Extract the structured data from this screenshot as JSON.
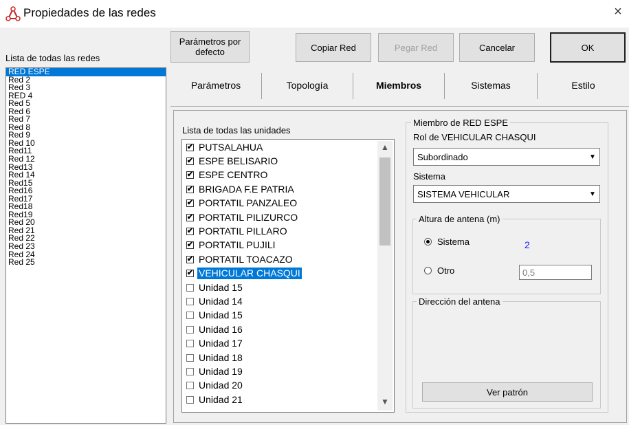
{
  "window": {
    "title": "Propiedades de las redes",
    "close_label": "×",
    "icon": "network-antenna-icon"
  },
  "toolbar": {
    "defaults_label": "Parámetros por defecto",
    "copy_label": "Copiar Red",
    "paste_label": "Pegar Red",
    "cancel_label": "Cancelar",
    "ok_label": "OK"
  },
  "networks": {
    "heading": "Lista de todas las redes",
    "selected": "RED ESPE",
    "items": [
      "RED ESPE",
      "Red  2",
      "Red  3",
      "RED 4",
      "Red  5",
      "Red  6",
      "Red  7",
      "Red  8",
      "Red  9",
      "Red 10",
      "Red11",
      "Red 12",
      "Red13",
      "Red 14",
      "Red15",
      "Red16",
      "Red17",
      "Red18",
      "Red19",
      "Red 20",
      "Red 21",
      "Red 22",
      "Red 23",
      "Red 24",
      "Red 25"
    ]
  },
  "tabs": [
    {
      "label": "Parámetros",
      "active": false
    },
    {
      "label": "Topología",
      "active": false
    },
    {
      "label": "Miembros",
      "active": true
    },
    {
      "label": "Sistemas",
      "active": false
    },
    {
      "label": "Estilo",
      "active": false
    }
  ],
  "units": {
    "heading": "Lista de todas las unidades",
    "items": [
      {
        "label": "PUTSALAHUA",
        "checked": true,
        "selected": false
      },
      {
        "label": "ESPE BELISARIO",
        "checked": true,
        "selected": false
      },
      {
        "label": "ESPE CENTRO",
        "checked": true,
        "selected": false
      },
      {
        "label": "BRIGADA F.E PATRIA",
        "checked": true,
        "selected": false
      },
      {
        "label": "PORTATIL PANZALEO",
        "checked": true,
        "selected": false
      },
      {
        "label": "PORTATIL PILIZURCO",
        "checked": true,
        "selected": false
      },
      {
        "label": "PORTATIL PILLARO",
        "checked": true,
        "selected": false
      },
      {
        "label": "PORTATIL PUJILI",
        "checked": true,
        "selected": false
      },
      {
        "label": "PORTATIL  TOACAZO",
        "checked": true,
        "selected": false
      },
      {
        "label": "VEHICULAR CHASQUI",
        "checked": true,
        "selected": true
      },
      {
        "label": "Unidad  15",
        "checked": false,
        "selected": false
      },
      {
        "label": "Unidad  14",
        "checked": false,
        "selected": false
      },
      {
        "label": "Unidad  15",
        "checked": false,
        "selected": false
      },
      {
        "label": "Unidad  16",
        "checked": false,
        "selected": false
      },
      {
        "label": "Unidad  17",
        "checked": false,
        "selected": false
      },
      {
        "label": "Unidad  18",
        "checked": false,
        "selected": false
      },
      {
        "label": "Unidad  19",
        "checked": false,
        "selected": false
      },
      {
        "label": "Unidad  20",
        "checked": false,
        "selected": false
      },
      {
        "label": "Unidad  21",
        "checked": false,
        "selected": false
      }
    ]
  },
  "member": {
    "group_title": "Miembro de RED ESPE",
    "role_label": "Rol de VEHICULAR CHASQUI",
    "role_value": "Subordinado",
    "system_label": "Sistema",
    "system_value": "SISTEMA VEHICULAR",
    "antenna_height": {
      "group_title": "Altura de antena (m)",
      "option_system_label": "Sistema",
      "system_value": "2",
      "option_other_label": "Otro",
      "other_value": "0,5",
      "selected": "Sistema"
    },
    "antenna_direction": {
      "group_title": "Dirección del antena",
      "pattern_button_label": "Ver patrón"
    }
  },
  "colors": {
    "selection": "#0078d7",
    "value_blue": "#1a1aff",
    "title_icon": "#cc2222"
  }
}
